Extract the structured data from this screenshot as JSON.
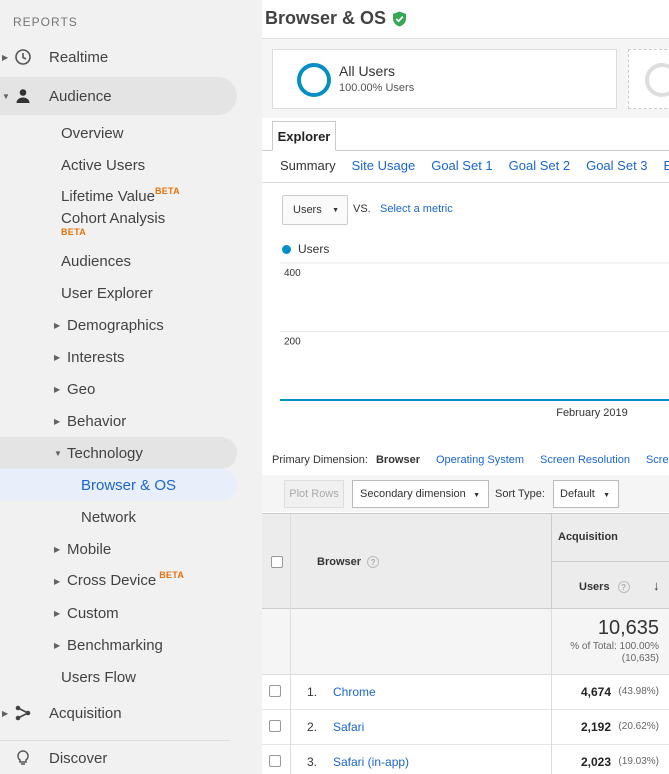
{
  "sidebar": {
    "header": "REPORTS",
    "realtime": "Realtime",
    "audience": "Audience",
    "items": [
      {
        "label": "Overview"
      },
      {
        "label": "Active Users"
      },
      {
        "label": "Lifetime Value",
        "badge": "BETA"
      },
      {
        "label": "Cohort Analysis",
        "badge": "BETA"
      },
      {
        "label": "Audiences"
      },
      {
        "label": "User Explorer"
      },
      {
        "label": "Demographics"
      },
      {
        "label": "Interests"
      },
      {
        "label": "Geo"
      },
      {
        "label": "Behavior"
      },
      {
        "label": "Technology"
      },
      {
        "label": "Browser & OS"
      },
      {
        "label": "Network"
      },
      {
        "label": "Mobile"
      },
      {
        "label": "Cross Device",
        "badge": "BETA"
      },
      {
        "label": "Custom"
      },
      {
        "label": "Benchmarking"
      },
      {
        "label": "Users Flow"
      }
    ],
    "acquisition": "Acquisition",
    "discover": "Discover"
  },
  "page": {
    "title": "Browser & OS"
  },
  "segment": {
    "name": "All Users",
    "pct": "100.00% Users"
  },
  "explorer": {
    "tab": "Explorer",
    "subtabs": [
      "Summary",
      "Site Usage",
      "Goal Set 1",
      "Goal Set 2",
      "Goal Set 3",
      "Ec"
    ]
  },
  "metric": {
    "selected": "Users",
    "vs": "VS.",
    "select_metric": "Select a metric"
  },
  "chart_data": {
    "type": "line",
    "series": [
      {
        "name": "Users",
        "values": [
          0,
          0,
          0,
          0,
          0
        ]
      }
    ],
    "yticks": [
      "400",
      "200"
    ],
    "xlabel_month": "February 2019",
    "ylim": [
      0,
      400
    ]
  },
  "primary_dimension": {
    "label": "Primary Dimension:",
    "current": "Browser",
    "options": [
      "Operating System",
      "Screen Resolution",
      "Screen"
    ]
  },
  "toolbar": {
    "plot_rows": "Plot Rows",
    "secondary_dimension": "Secondary dimension",
    "sort_type_label": "Sort Type:",
    "sort_type": "Default"
  },
  "table": {
    "col_browser": "Browser",
    "group_acquisition": "Acquisition",
    "col_users": "Users",
    "total": {
      "value": "10,635",
      "pct_line1": "% of Total: 100.00%",
      "pct_line2": "(10,635)"
    },
    "rows": [
      {
        "num": "1.",
        "name": "Chrome",
        "users": "4,674",
        "pct": "(43.98%)"
      },
      {
        "num": "2.",
        "name": "Safari",
        "users": "2,192",
        "pct": "(20.62%)"
      },
      {
        "num": "3.",
        "name": "Safari (in-app)",
        "users": "2,023",
        "pct": "(19.03%)"
      }
    ]
  },
  "colors": {
    "accent": "#058dc7",
    "link": "#1a66cc",
    "beta": "#e8710a",
    "verified": "#34a853"
  },
  "icons": [
    "clock-icon",
    "person-icon",
    "acquisition-icon",
    "lightbulb-icon",
    "verified-shield-icon"
  ]
}
